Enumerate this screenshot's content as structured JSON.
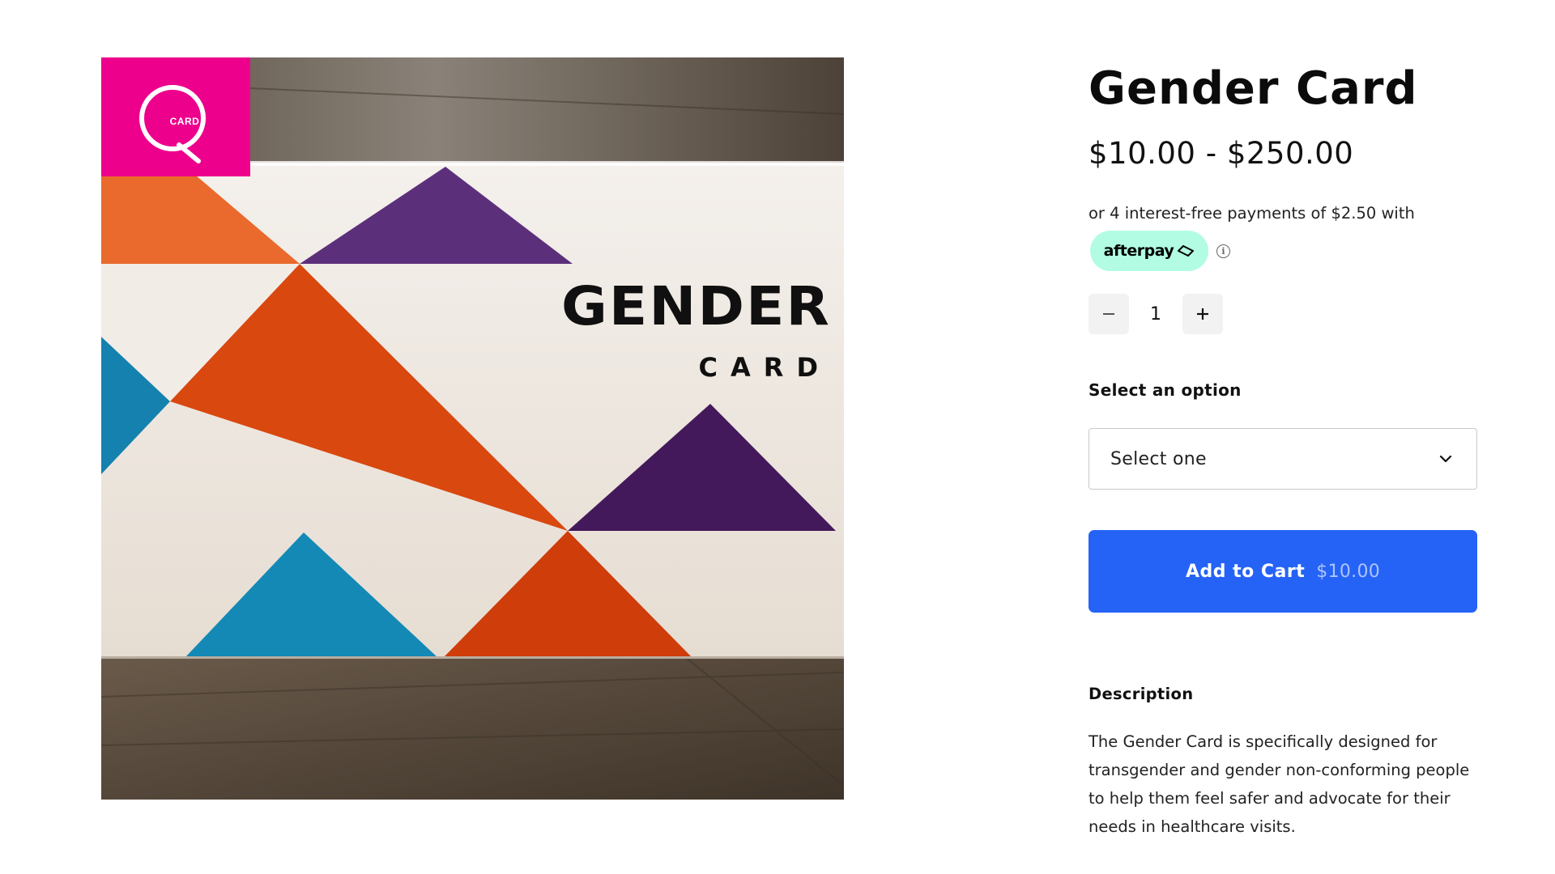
{
  "product": {
    "brand_logo_text": "CARD",
    "card_print": {
      "line1": "GENDER",
      "line2": "CARD"
    },
    "title": "Gender Card",
    "price_range": "$10.00 - $250.00",
    "installments_text": "or 4 interest-free payments of $2.50 with",
    "afterpay_label": "afterpay",
    "info_icon": "info-icon",
    "quantity": "1",
    "option_label": "Select an option",
    "option_selected": "Select one",
    "add_to_cart": {
      "label": "Add to Cart",
      "price": "$10.00"
    },
    "description_heading": "Description",
    "description_body": "The Gender Card is specifically designed for transgender and gender non-conforming people to help them feel safer and advocate for their needs in healthcare visits."
  },
  "colors": {
    "brand_pink": "#ec008c",
    "afterpay_mint": "#b2fce4",
    "button_blue": "#2563f6",
    "card_orange": "#d9480f",
    "card_purple": "#5b2b78",
    "card_teal": "#1487b4"
  },
  "icons": [
    "minus-icon",
    "plus-icon",
    "chevron-down-icon",
    "afterpay-arrows-icon",
    "info-icon",
    "q-logo-icon"
  ]
}
